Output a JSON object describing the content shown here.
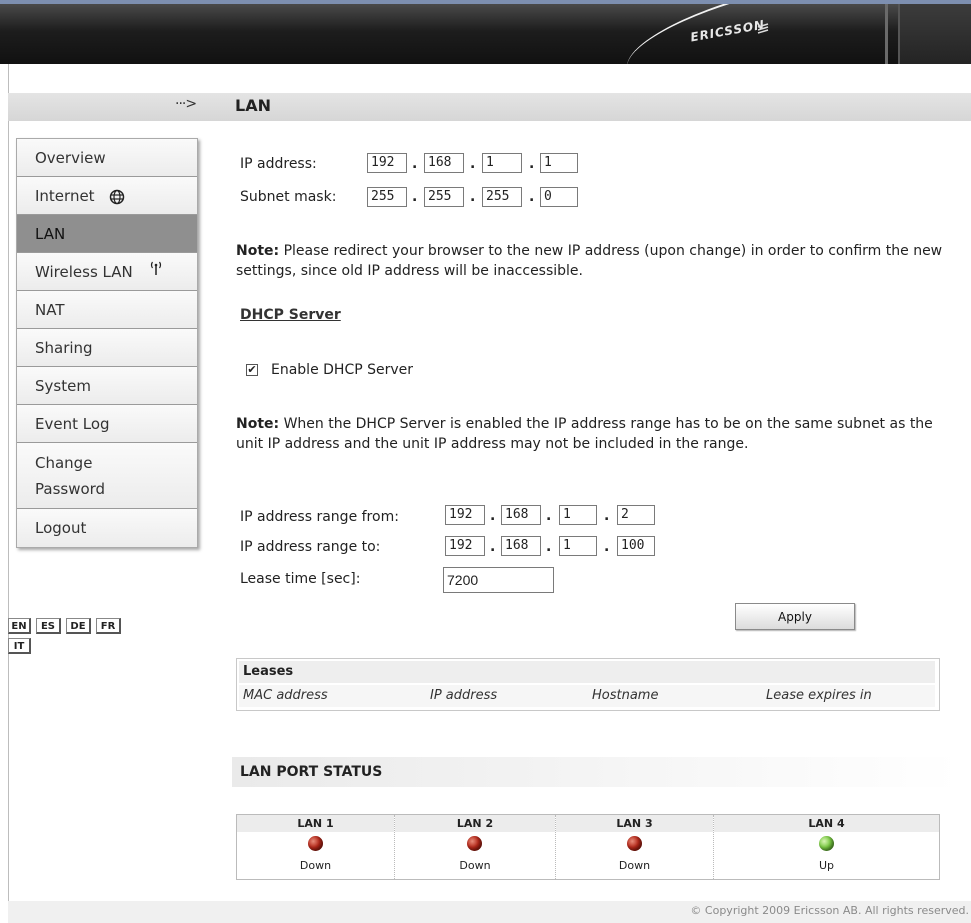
{
  "header": {
    "brand": "ERICSSON"
  },
  "page": {
    "arrow": "···>",
    "title": "LAN"
  },
  "sidebar": {
    "items": [
      {
        "label": "Overview"
      },
      {
        "label": "Internet"
      },
      {
        "label": "LAN"
      },
      {
        "label": "Wireless LAN"
      },
      {
        "label": "NAT"
      },
      {
        "label": "Sharing"
      },
      {
        "label": "System"
      },
      {
        "label": "Event Log"
      },
      {
        "label_line1": "Change",
        "label_line2": "Password"
      },
      {
        "label": "Logout"
      }
    ],
    "active": "LAN"
  },
  "languages": [
    "EN",
    "ES",
    "DE",
    "FR",
    "IT"
  ],
  "lan": {
    "ip_label": "IP address:",
    "ip": [
      "192",
      "168",
      "1",
      "1"
    ],
    "mask_label": "Subnet mask:",
    "mask": [
      "255",
      "255",
      "255",
      "0"
    ],
    "note1_bold": "Note:",
    "note1_text": " Please redirect your browser to the new IP address (upon change) in order to confirm the new settings, since old IP address will be inaccessible."
  },
  "dhcp": {
    "section_title": "DHCP Server",
    "enable_label": "Enable DHCP Server",
    "enabled": true,
    "note2_bold": "Note:",
    "note2_text": " When the DHCP Server is enabled the IP address range has to be on the same subnet as the unit IP address and the unit IP address may not be included in the range.",
    "from_label": "IP address range from:",
    "from": [
      "192",
      "168",
      "1",
      "2"
    ],
    "to_label": "IP address range to:",
    "to": [
      "192",
      "168",
      "1",
      "100"
    ],
    "lease_label": "Lease time [sec]:",
    "lease_value": "7200",
    "apply_label": "Apply"
  },
  "leases": {
    "title": "Leases",
    "columns": [
      "MAC address",
      "IP address",
      "Hostname",
      "Lease expires in"
    ]
  },
  "port_status": {
    "title": "LAN PORT STATUS",
    "ports": [
      {
        "name": "LAN 1",
        "status": "Down",
        "color": "#b3281a"
      },
      {
        "name": "LAN 2",
        "status": "Down",
        "color": "#b3281a"
      },
      {
        "name": "LAN 3",
        "status": "Down",
        "color": "#b3281a"
      },
      {
        "name": "LAN 4",
        "status": "Up",
        "color": "#7ac943"
      }
    ]
  },
  "footer": {
    "copyright": "© Copyright 2009 Ericsson AB. All rights reserved."
  }
}
